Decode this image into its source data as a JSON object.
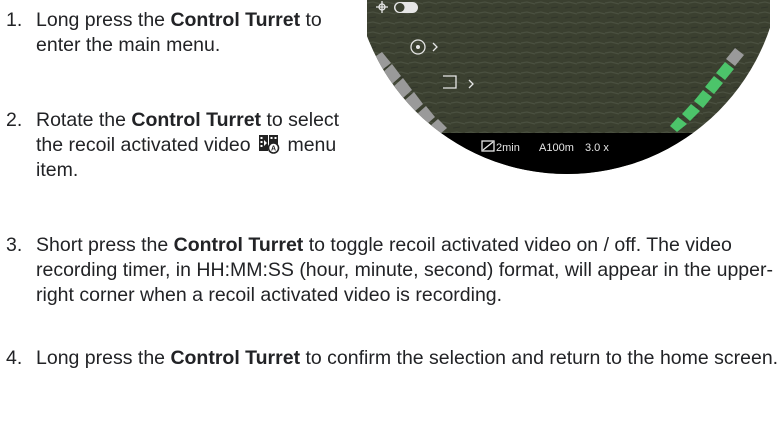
{
  "steps": [
    {
      "number": "1.",
      "parts": [
        "Long press the ",
        "Control Turret",
        " to enter the main menu."
      ]
    },
    {
      "number": "2.",
      "parts": [
        "Rotate the ",
        "Control Turret",
        " to select the recoil activated video ",
        " menu item."
      ]
    },
    {
      "number": "3.",
      "parts": [
        "Short press the ",
        "Control Turret",
        " to toggle recoil activated video on / off. The video recording timer, in HH:MM:SS (hour, minute, second) format, will appear in the upper-right corner when a recoil activated video is recording."
      ]
    },
    {
      "number": "4.",
      "parts": [
        "Long press the ",
        "Control Turret",
        " to confirm the selection and return to the home screen."
      ]
    }
  ],
  "scope": {
    "status_timer": "2min",
    "status_range": "A100m",
    "status_zoom": "3.0 x",
    "menu_items": [
      {
        "icon": "drone-icon",
        "control": "toggle",
        "state": "off"
      },
      {
        "icon": "crosshair-gear-icon",
        "control": "chevron"
      },
      {
        "icon": "frame-icon",
        "control": "chevron"
      }
    ]
  },
  "colors": {
    "scope_bg": "#3d4232",
    "scope_frame": "#000000",
    "status_text": "#e6e6e6",
    "left_bar": "#9a9a9a",
    "right_bar": "#4cc46a"
  }
}
